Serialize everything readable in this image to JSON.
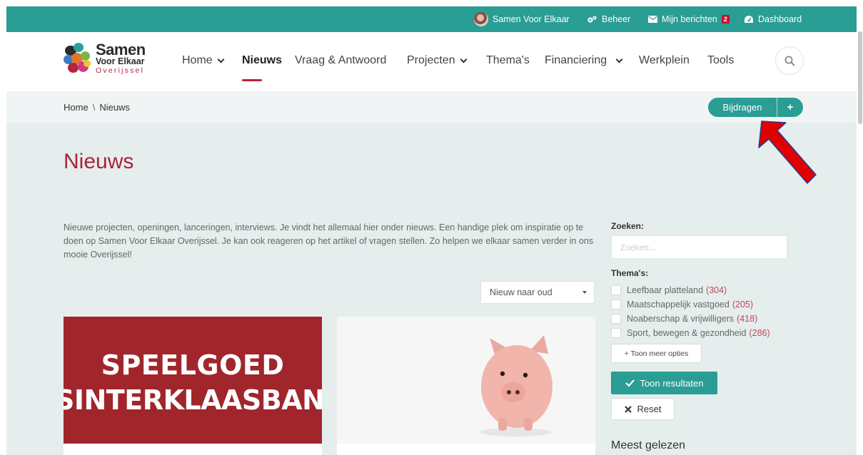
{
  "topbar": {
    "user_name": "Samen Voor Elkaar",
    "beheer": "Beheer",
    "messages": "Mijn berichten",
    "messages_count": "2",
    "dashboard": "Dashboard"
  },
  "logo": {
    "line1": "Samen",
    "line2": "Voor Elkaar",
    "line3": "Overijssel"
  },
  "nav": {
    "items": [
      "Home",
      "Nieuws",
      "Vraag & Antwoord",
      "Projecten",
      "Thema's",
      "Financiering",
      "Werkplein",
      "Tools"
    ]
  },
  "breadcrumb": {
    "home": "Home",
    "separator": "\\",
    "current": "Nieuws"
  },
  "contribute": {
    "label": "Bijdragen",
    "plus": "+"
  },
  "main": {
    "title": "Nieuws",
    "intro": "Nieuwe projecten, openingen, lanceringen, interviews. Je vindt het allemaal hier onder nieuws. Een handige plek om inspiratie op te doen op Samen Voor Elkaar Overijssel. Je kan ook reageren op het artikel of vragen stellen. Zo helpen we elkaar samen verder in ons mooie Overijssel!",
    "sort_selected": "Nieuw naar oud"
  },
  "cards": [
    {
      "image_text_line1": "SPEELGOED",
      "image_text_line2": "SINTERKLAASBANK"
    }
  ],
  "sidebar": {
    "search_label": "Zoeken:",
    "search_placeholder": "Zoeken...",
    "themes_label": "Thema's:",
    "themes": [
      {
        "label": "Leefbaar platteland",
        "count": "(304)"
      },
      {
        "label": "Maatschappelijk vastgoed",
        "count": "(205)"
      },
      {
        "label": "Noaberschap & vrijwilligers",
        "count": "(418)"
      },
      {
        "label": "Sport, bewegen & gezondheid",
        "count": "(286)"
      }
    ],
    "more_options": "+ Toon meer opties",
    "show_results": "Toon resultaten",
    "reset": "Reset",
    "most_read": "Meest gelezen"
  },
  "colors": {
    "teal": "#2a9d94",
    "brand_red": "#a8243a",
    "card_red": "#a0262c",
    "annotation_arrow": "#e00000"
  }
}
